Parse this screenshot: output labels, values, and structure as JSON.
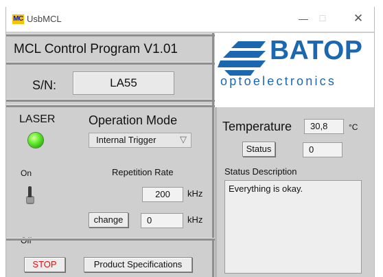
{
  "window": {
    "app_icon_text": "MC",
    "title": "UsbMCL",
    "minimize_glyph": "—",
    "maximize_glyph": "☐",
    "close_glyph": "✕"
  },
  "header": {
    "program_title": "MCL Control Program V1.01",
    "sn_label": "S/N:",
    "sn_value": "LA55"
  },
  "logo": {
    "name": "BATOP",
    "tagline": "optoelectronics",
    "color": "#1b67b0"
  },
  "laser": {
    "label": "LASER",
    "indicator_color": "#44d41f",
    "on_label": "On",
    "off_label": "Off"
  },
  "operation": {
    "label": "Operation Mode",
    "selected": "Internal Trigger",
    "repetition_label": "Repetition Rate",
    "repetition_value": "200",
    "repetition_unit": "kHz",
    "change_label": "change",
    "change_value": "0",
    "change_unit": "kHz"
  },
  "status": {
    "temperature_label": "Temperature",
    "temperature_value": "30,8",
    "temperature_unit": "°C",
    "status_button": "Status",
    "status_value": "0",
    "description_label": "Status Description",
    "description_text": "Everything is okay."
  },
  "footer": {
    "stop_label": "STOP",
    "spec_label": "Product Specifications",
    "stop_color": "#d11111"
  }
}
